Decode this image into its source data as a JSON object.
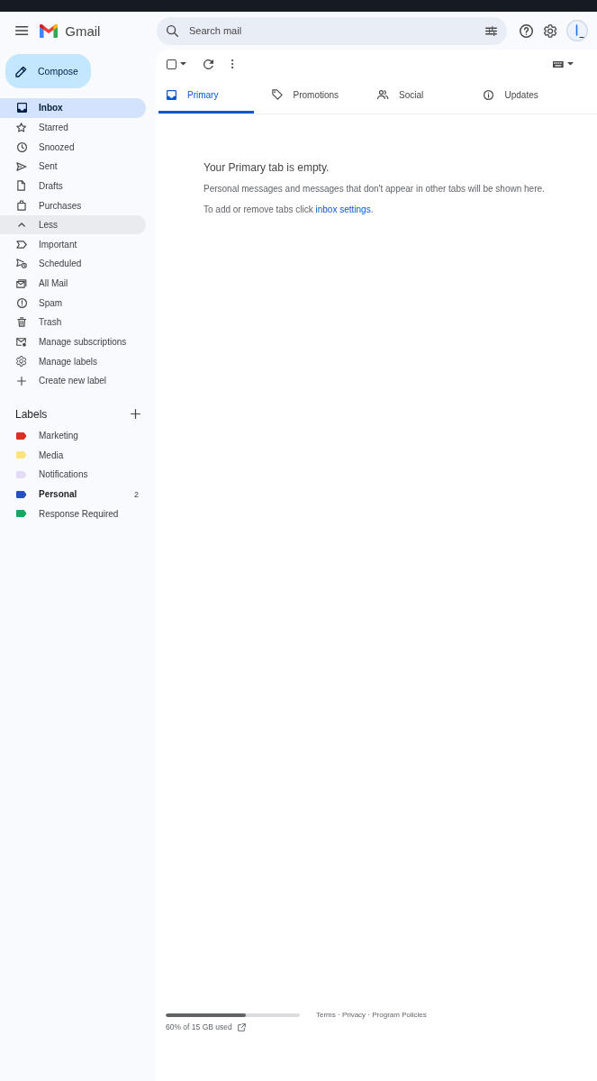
{
  "header": {
    "logo": "Gmail",
    "search": {
      "placeholder": "Search mail"
    }
  },
  "compose": {
    "label": "Compose"
  },
  "sidebar": {
    "items": [
      {
        "label": "Inbox",
        "selected": true,
        "hovered": false
      },
      {
        "label": "Starred",
        "selected": false,
        "hovered": false
      },
      {
        "label": "Snoozed",
        "selected": false,
        "hovered": false
      },
      {
        "label": "Sent",
        "selected": false,
        "hovered": false
      },
      {
        "label": "Drafts",
        "selected": false,
        "hovered": false
      },
      {
        "label": "Purchases",
        "selected": false,
        "hovered": false
      },
      {
        "label": "Less",
        "selected": false,
        "hovered": true
      },
      {
        "label": "Important",
        "selected": false,
        "hovered": false
      },
      {
        "label": "Scheduled",
        "selected": false,
        "hovered": false
      },
      {
        "label": "All Mail",
        "selected": false,
        "hovered": false
      },
      {
        "label": "Spam",
        "selected": false,
        "hovered": false
      },
      {
        "label": "Trash",
        "selected": false,
        "hovered": false
      },
      {
        "label": "Manage subscriptions",
        "selected": false,
        "hovered": false
      },
      {
        "label": "Manage labels",
        "selected": false,
        "hovered": false
      },
      {
        "label": "Create new label",
        "selected": false,
        "hovered": false
      }
    ]
  },
  "labels": {
    "title": "Labels",
    "items": [
      {
        "name": "Marketing",
        "color": "#d93025",
        "unread": false
      },
      {
        "name": "Media",
        "color": "#fce47c",
        "unread": false
      },
      {
        "name": "Notifications",
        "color": "#e4dcf7",
        "unread": false
      },
      {
        "name": "Personal",
        "color": "#2450c0",
        "unread": true,
        "count": "2"
      },
      {
        "name": "Response Required",
        "color": "#16a765",
        "unread": false
      }
    ]
  },
  "toolbar": {
    "select_all": {
      "checked": false
    }
  },
  "tabs": [
    {
      "label": "Primary",
      "selected": true
    },
    {
      "label": "Promotions",
      "selected": false
    },
    {
      "label": "Social",
      "selected": false
    },
    {
      "label": "Updates",
      "selected": false
    }
  ],
  "empty_state": {
    "title": "Your Primary tab is empty.",
    "message": "Personal messages and messages that don't appear in other tabs will be shown here.",
    "hint": {
      "text": "To add or remove tabs click ",
      "link": "inbox settings",
      "after": "."
    }
  },
  "footer": {
    "storage": {
      "level": 0.6,
      "text": "60% of 15 GB used"
    },
    "links": [
      "Terms",
      "Privacy",
      "Program Policies"
    ],
    "separator": " · "
  }
}
